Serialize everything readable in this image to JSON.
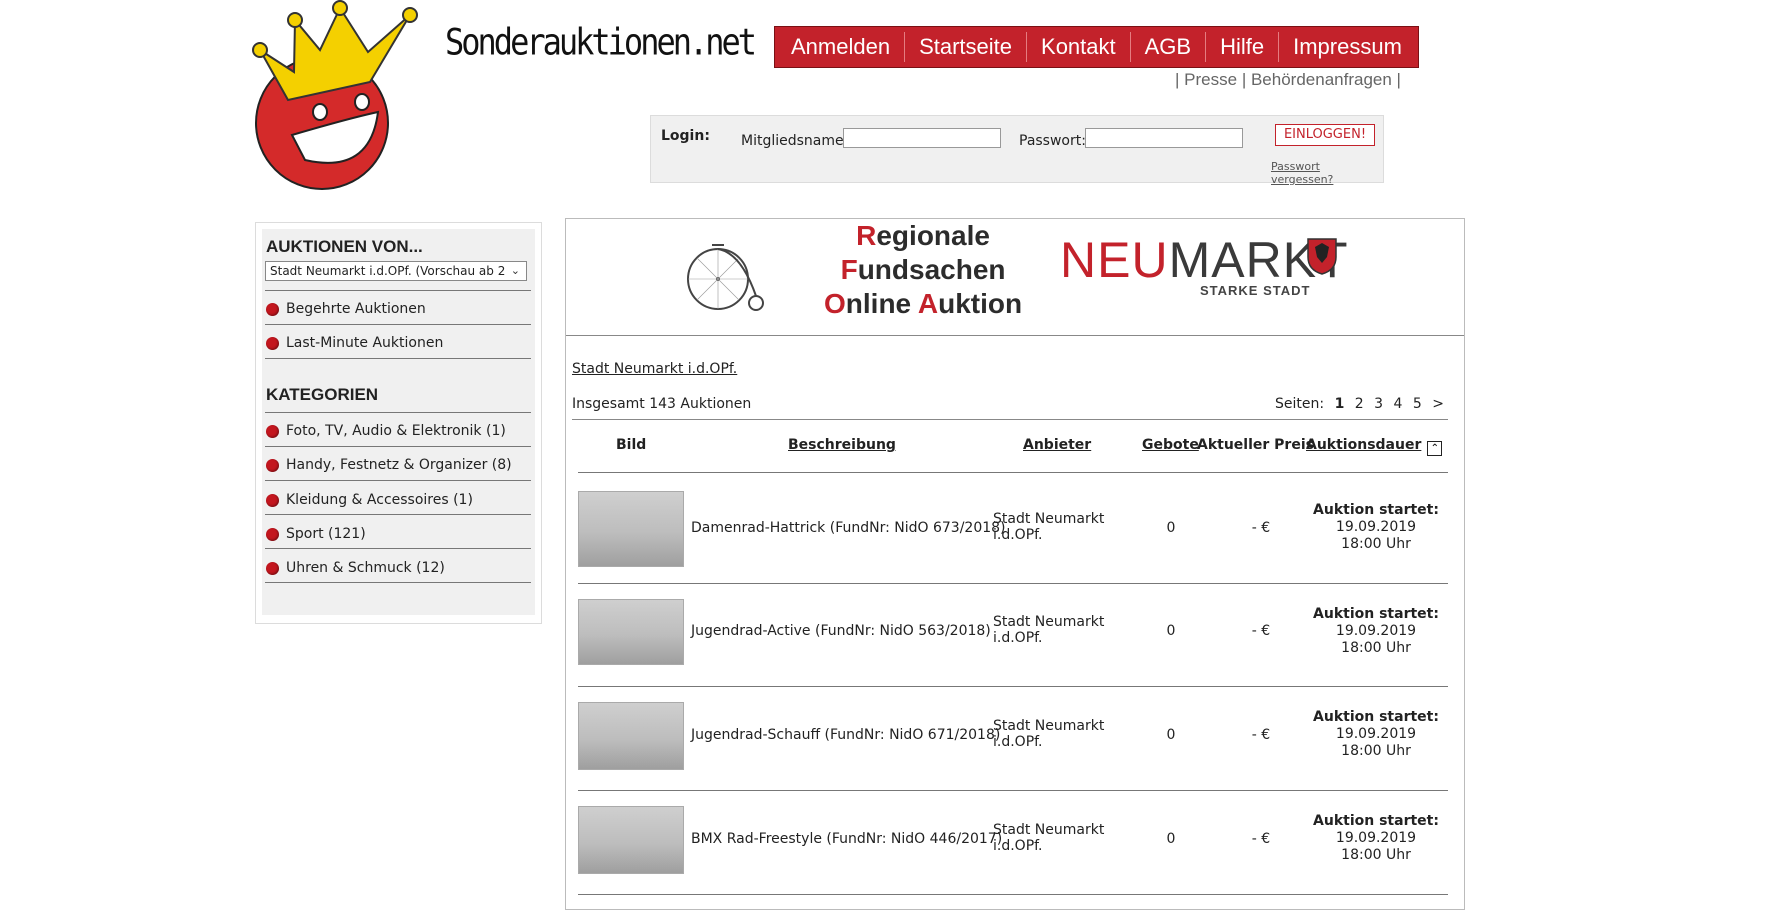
{
  "site": {
    "name": "Sonderauktionen.net"
  },
  "topnav": {
    "items": [
      {
        "label": "Anmelden"
      },
      {
        "label": "Startseite"
      },
      {
        "label": "Kontakt"
      },
      {
        "label": "AGB"
      },
      {
        "label": "Hilfe"
      },
      {
        "label": "Impressum"
      }
    ]
  },
  "subnav": {
    "items": [
      {
        "label": "Presse"
      },
      {
        "label": "Behördenanfragen"
      }
    ],
    "separator": "|"
  },
  "login": {
    "title": "Login:",
    "username_label": "Mitgliedsname:",
    "username_value": "",
    "password_label": "Passwort:",
    "password_value": "",
    "button": "EINLOGGEN!",
    "forgot": "Passwort vergessen?"
  },
  "sidebar": {
    "auctions_heading": "AUKTIONEN VON...",
    "auction_select": "Stadt Neumarkt i.d.OPf. (Vorschau ab 2",
    "auction_links": [
      {
        "label": "Begehrte Auktionen"
      },
      {
        "label": "Last-Minute Auktionen"
      }
    ],
    "categories_heading": "KATEGORIEN",
    "categories": [
      {
        "label": "Foto, TV, Audio & Elektronik (1)"
      },
      {
        "label": "Handy, Festnetz & Organizer (8)"
      },
      {
        "label": "Kleidung & Accessoires (1)"
      },
      {
        "label": "Sport (121)"
      },
      {
        "label": "Uhren & Schmuck (12)"
      }
    ]
  },
  "banner": {
    "line1_initial": "R",
    "line1_rest": "egionale",
    "line2_initial": "F",
    "line2_rest": "undsachen",
    "line3_initial": "O",
    "line3_mid": "nline ",
    "line3_initial2": "A",
    "line3_rest": "uktion",
    "logo_neu": "NEU",
    "logo_m": "M",
    "logo_arkt": "ARKT",
    "logo_sub": "STARKE STADT"
  },
  "main": {
    "breadcrumb": "Stadt Neumarkt i.d.OPf.",
    "total": "Insgesamt 143 Auktionen",
    "pages_label": "Seiten:",
    "pages": [
      "1",
      "2",
      "3",
      "4",
      "5",
      ">"
    ],
    "current_page": "1",
    "columns": {
      "image": "Bild",
      "description": "Beschreibung",
      "vendor": "Anbieter",
      "bids": "Gebote",
      "price": "Aktueller Preis",
      "duration": "Auktionsdauer"
    },
    "rows": [
      {
        "description": "Damenrad-Hattrick (FundNr: NidO 673/2018)",
        "vendor_line1": "Stadt Neumarkt",
        "vendor_line2": "i.d.OPf.",
        "bids": "0",
        "price": "- €",
        "status": "Auktion startet:",
        "date": "19.09.2019",
        "time": "18:00 Uhr"
      },
      {
        "description": "Jugendrad-Active (FundNr: NidO 563/2018)",
        "vendor_line1": "Stadt Neumarkt",
        "vendor_line2": "i.d.OPf.",
        "bids": "0",
        "price": "- €",
        "status": "Auktion startet:",
        "date": "19.09.2019",
        "time": "18:00 Uhr"
      },
      {
        "description": "Jugendrad-Schauff (FundNr: NidO 671/2018)",
        "vendor_line1": "Stadt Neumarkt",
        "vendor_line2": "i.d.OPf.",
        "bids": "0",
        "price": "- €",
        "status": "Auktion startet:",
        "date": "19.09.2019",
        "time": "18:00 Uhr"
      },
      {
        "description": "BMX Rad-Freestyle (FundNr: NidO 446/2017)",
        "vendor_line1": "Stadt Neumarkt",
        "vendor_line2": "i.d.OPf.",
        "bids": "0",
        "price": "- €",
        "status": "Auktion startet:",
        "date": "19.09.2019",
        "time": "18:00 Uhr"
      }
    ]
  },
  "colors": {
    "brand_red": "#c3222b",
    "panel_gray": "#f0f0f0"
  },
  "icons": [
    "crown-smiley-logo-icon",
    "penny-farthing-icon",
    "coat-of-arms-icon",
    "bullet-dot-icon",
    "sort-up-icon",
    "chevron-down-icon"
  ]
}
